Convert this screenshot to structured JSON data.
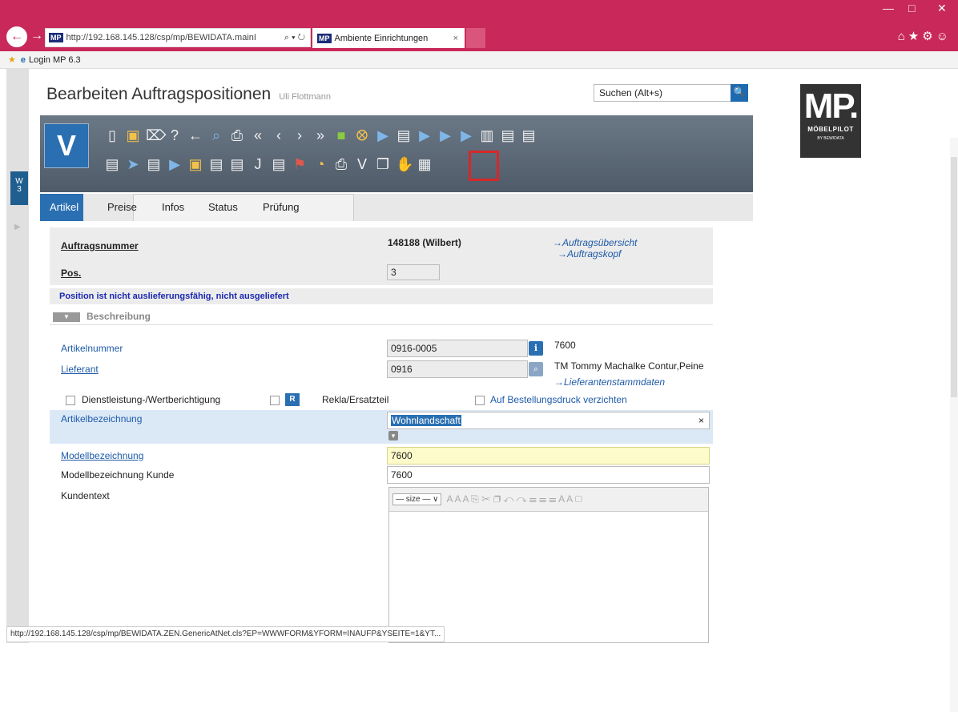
{
  "browser": {
    "url": "http://192.168.145.128/csp/mp/BEWIDATA.mainI",
    "url_controls": "⌕ ▾ ↻",
    "mp_tag": "MP",
    "tab_title": "Ambiente Einrichtungen",
    "tab_close": "×",
    "minimize": "—",
    "maximize": "□",
    "close": "✕",
    "right_icons": "⌂★⚙☺",
    "favorite": "Login MP 6.3"
  },
  "page": {
    "title": "Bearbeiten Auftragspositionen",
    "user": "Uli Flottmann",
    "search_value": "Suchen (Alt+s)",
    "search_icon": "🔍"
  },
  "logo": {
    "big": "MP.",
    "sub": "MÖBELPILOT",
    "tiny": "BY BEWIDATA"
  },
  "sidebar": {
    "tab_top": "W",
    "tab_bottom": "3"
  },
  "toolbar": {
    "v_label": "V",
    "row1": [
      "doc-new",
      "yel-folder",
      "trash",
      "help",
      "back",
      "zoom",
      "print",
      "first",
      "prev",
      "next",
      "last",
      "grn-cube",
      "tag",
      "truck",
      "doc-green",
      "truck2",
      "truck3",
      "truck4",
      "doc-chart",
      "doc-yellow",
      "doc-blue"
    ],
    "row2": [
      "doc-red",
      "truck-arrow",
      "doc-red2",
      "truck-yellow",
      "book",
      "doc-list",
      "doc-green2",
      "doc-j",
      "doc-check",
      "flag",
      "gauge",
      "printer",
      "v-letter",
      "copy-doc",
      "doc-hand",
      "doc-image"
    ],
    "row1_glyphs": [
      "▯",
      "▣",
      "⌦",
      "?",
      "←",
      "⌕",
      "⎙",
      "«",
      "‹",
      "›",
      "»",
      "■",
      "⭙",
      "▶",
      "▤",
      "▶",
      "▶",
      "▶",
      "▥",
      "▤",
      "▤"
    ],
    "row2_glyphs": [
      "▤",
      "➤",
      "▤",
      "▶",
      "▣",
      "▤",
      "▤",
      "J",
      "▤",
      "⚑",
      "◔",
      "⎙",
      "V",
      "❐",
      "✋",
      "▦"
    ]
  },
  "tabs": [
    "Artikel",
    "Preise",
    "Infos",
    "Status",
    "Prüfung"
  ],
  "form": {
    "auftragsnummer_label": "Auftragsnummer",
    "auftragsnummer_value": "148188 (Wilbert)",
    "link_uebersicht": "→Auftragsübersicht",
    "link_kopf": "→Auftragskopf",
    "pos_label": "Pos.",
    "pos_value": "3",
    "notice": "Position ist nicht auslieferungsfähig, nicht ausgeliefert",
    "section": "Beschreibung",
    "section_toggle": "▼",
    "artikelnummer_label": "Artikelnummer",
    "artikelnummer_value": "0916-0005",
    "artikelnummer_btn": "ℹ",
    "artikelnummer_ref": "7600",
    "lieferant_label": "Lieferant",
    "lieferant_value": "0916",
    "lieferant_btn": "⌕",
    "lieferant_name": "TM Tommy Machalke Contur,Peine",
    "link_lieferant": "→Lieferantenstammdaten",
    "chk_dienstleistung": "Dienstleistung-/Wertberichtigung",
    "r_label": "R",
    "chk_rekla": "Rekla/Ersatzteil",
    "chk_bestellung": "Auf Bestellungsdruck verzichten",
    "artikelbezeichnung_label": "Artikelbezeichnung",
    "artikelbezeichnung_value": "Wohnlandschaft",
    "clear": "×",
    "dropdown": "▾",
    "modellbezeichnung_label": "Modellbezeichnung",
    "modellbezeichnung_value": "7600",
    "modell_kunde_label": "Modellbezeichnung Kunde",
    "modell_kunde_value": "7600",
    "kundentext_label": "Kundentext",
    "size_select": "— size — ∨",
    "rte_glyphs": "A A A   ⎘ ✂ ❐   ↶ ↷   ☰ ☰ ☰   A A  ▢"
  },
  "status_url": "http://192.168.145.128/csp/mp/BEWIDATA.ZEN.GenericAtNet.cls?EP=WWWFORM&YFORM=INAUFP&YSEITE=1&YT...",
  "colors": {
    "accent": "#c8285a",
    "primary": "#2a6fb2",
    "notice": "#1a28b0"
  }
}
